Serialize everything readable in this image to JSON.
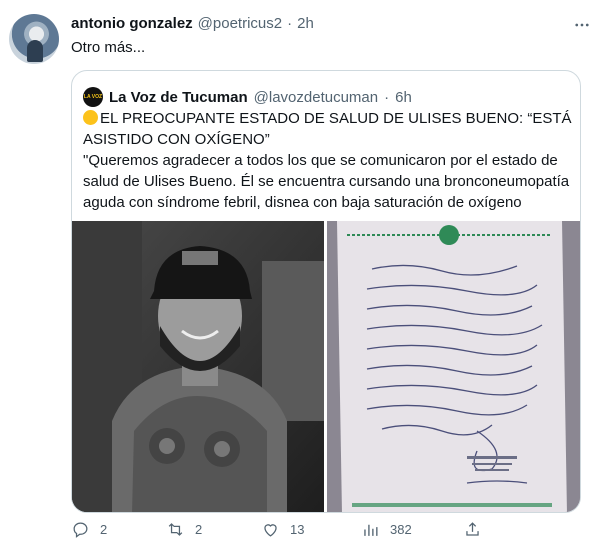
{
  "tweet": {
    "author_name": "antonio gonzalez",
    "author_handle": "@poetricus2",
    "separator": "·",
    "time": "2h",
    "text": "Otro más..."
  },
  "quote": {
    "logo_text": "LA VOZ",
    "author_name": "La Voz de Tucuman",
    "author_handle": "@lavozdetucuman",
    "separator": "·",
    "time": "6h",
    "headline": "EL PREOCUPANTE ESTADO DE SALUD DE ULISES BUENO: “ESTÁ ASISTIDO CON OXÍGENO”",
    "body": "\"Queremos agradecer a todos los que se comunicaron por el estado de salud de Ulises Bueno. Él se encuentra cursando una bronconeumopatía aguda con síndrome febril, disnea con baja saturación de oxígeno",
    "emoji": "yellow-circle"
  },
  "actions": {
    "replies": "2",
    "retweets": "2",
    "likes": "13",
    "views": "382"
  },
  "icons": [
    "more-icon",
    "reply-icon",
    "retweet-icon",
    "like-icon",
    "views-icon",
    "share-icon"
  ],
  "colors": {
    "muted": "#536471",
    "border": "#cfd9de",
    "text": "#0f1419"
  }
}
